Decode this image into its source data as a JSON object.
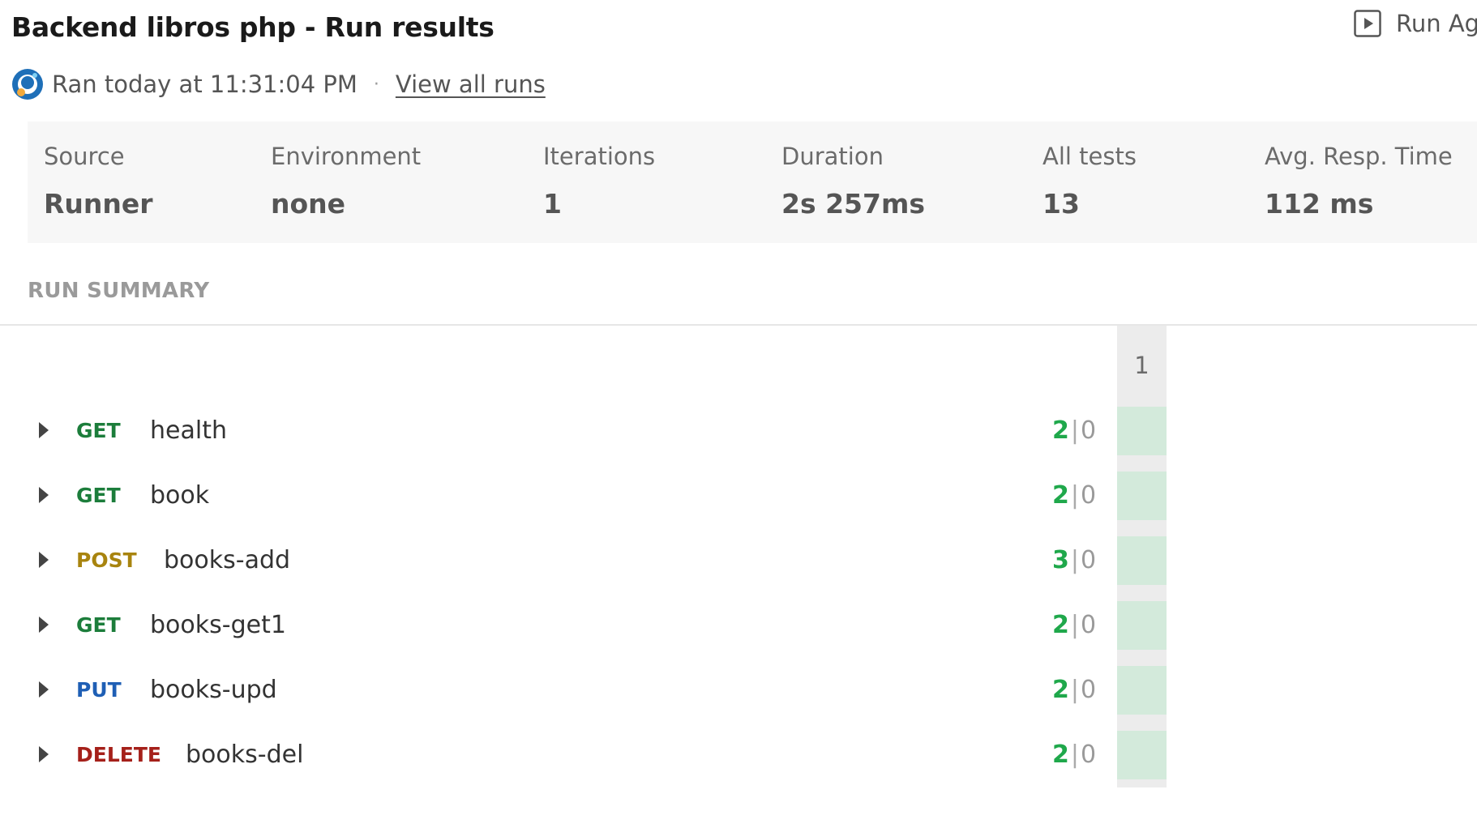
{
  "header": {
    "title": "Backend libros php - Run results",
    "run_again_label": "Run Ag",
    "ran_text": "Ran today at 11:31:04 PM",
    "separator": "·",
    "view_all_runs": "View all runs"
  },
  "stats": [
    {
      "label": "Source",
      "value": "Runner"
    },
    {
      "label": "Environment",
      "value": "none"
    },
    {
      "label": "Iterations",
      "value": "1"
    },
    {
      "label": "Duration",
      "value": "2s 257ms"
    },
    {
      "label": "All tests",
      "value": "13"
    },
    {
      "label": "Avg. Resp. Time",
      "value": "112 ms"
    }
  ],
  "summary": {
    "title": "RUN SUMMARY",
    "iteration_header": "1",
    "count_separator": "|",
    "requests": [
      {
        "method": "GET",
        "name": "health",
        "passed": "2",
        "failed": "0"
      },
      {
        "method": "GET",
        "name": "book",
        "passed": "2",
        "failed": "0"
      },
      {
        "method": "POST",
        "name": "books-add",
        "passed": "3",
        "failed": "0"
      },
      {
        "method": "GET",
        "name": "books-get1",
        "passed": "2",
        "failed": "0"
      },
      {
        "method": "PUT",
        "name": "books-upd",
        "passed": "2",
        "failed": "0"
      },
      {
        "method": "DELETE",
        "name": "books-del",
        "passed": "2",
        "failed": "0"
      }
    ]
  },
  "colors": {
    "GET": "#1c7d3b",
    "POST": "#a8840f",
    "PUT": "#1f5fb5",
    "DELETE": "#a5201a",
    "pass": "#1fa84b",
    "iteration_pass_cell": "#d3eadb"
  },
  "icons": {
    "run_again": "play-square-icon",
    "runner": "runner-avatar-icon",
    "expand": "caret-right-icon"
  }
}
